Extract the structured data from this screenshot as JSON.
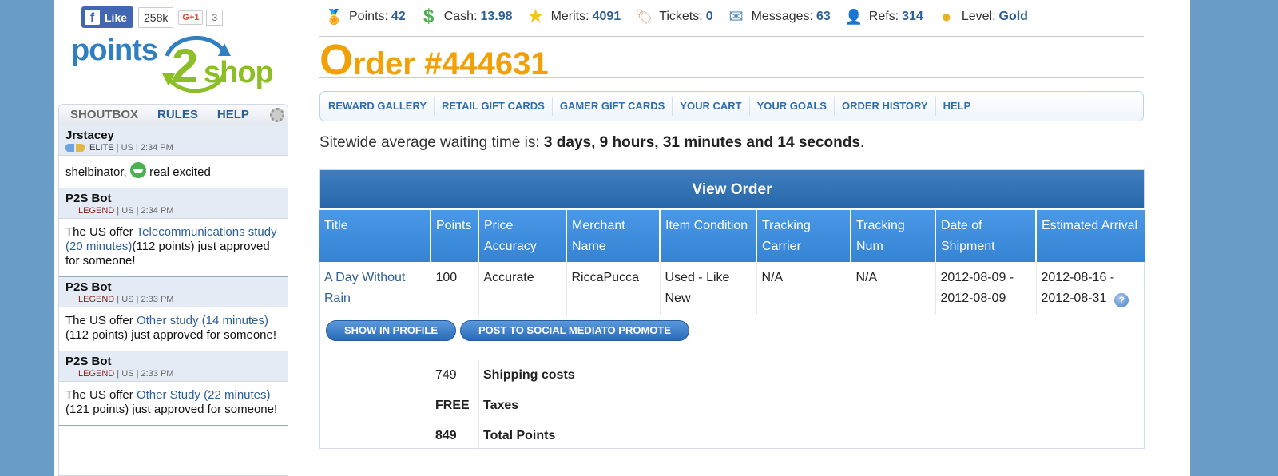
{
  "social": {
    "fb_like": "Like",
    "fb_count": "258k",
    "gplus": "+1",
    "gplus_count": "3"
  },
  "logo": {
    "points": "points",
    "two": "2",
    "shop": "shop"
  },
  "shoutbox": {
    "tabs": [
      "SHOUTBOX",
      "RULES",
      "HELP"
    ],
    "messages": [
      {
        "user": "Jrstacey",
        "rank": "ELITE",
        "region": "US",
        "time": "2:34 PM",
        "pre": "shelbinator,",
        "link": "",
        "post": "real excited"
      },
      {
        "user": "P2S Bot",
        "rank": "LEGEND",
        "region": "US",
        "time": "2:34 PM",
        "pre": "The US offer",
        "link": "Telecommunications study (20 minutes)",
        "post": "(112 points) just approved for someone!"
      },
      {
        "user": "P2S Bot",
        "rank": "LEGEND",
        "region": "US",
        "time": "2:33 PM",
        "pre": "The US offer",
        "link": "Other study (14 minutes)",
        "post": "(112 points) just approved for someone!"
      },
      {
        "user": "P2S Bot",
        "rank": "LEGEND",
        "region": "US",
        "time": "2:33 PM",
        "pre": "The US offer",
        "link": "Other Study (22 minutes)",
        "post": "(121 points) just approved for someone!"
      }
    ]
  },
  "stats": [
    {
      "label": "Points:",
      "value": "42",
      "icon": "points-medal-icon",
      "glyph": "🏅"
    },
    {
      "label": "Cash:",
      "value": "13.98",
      "icon": "dollar-icon",
      "glyph": "$"
    },
    {
      "label": "Merits:",
      "value": "4091",
      "icon": "star-icon",
      "glyph": "★"
    },
    {
      "label": "Tickets:",
      "value": "0",
      "icon": "ticket-icon",
      "glyph": "🏷"
    },
    {
      "label": "Messages:",
      "value": "63",
      "icon": "envelope-icon",
      "glyph": "✉"
    },
    {
      "label": "Refs:",
      "value": "314",
      "icon": "user-icon",
      "glyph": "👤"
    },
    {
      "label": "Level:",
      "value": "Gold",
      "icon": "gold-medal-icon",
      "glyph": "●"
    }
  ],
  "page": {
    "title_first": "O",
    "title_rest": "rder #444631"
  },
  "nav": [
    "REWARD GALLERY",
    "RETAIL GIFT CARDS",
    "GAMER GIFT CARDS",
    "YOUR CART",
    "YOUR GOALS",
    "ORDER HISTORY",
    "HELP"
  ],
  "wait": {
    "prefix": "Sitewide average waiting time is:",
    "value": "3 days, 9 hours, 31 minutes and 14 seconds",
    "suffix": "."
  },
  "order": {
    "heading": "View Order",
    "columns": [
      "Title",
      "Points",
      "Price Accuracy",
      "Merchant Name",
      "Item Condition",
      "Tracking Carrier",
      "Tracking Num",
      "Date of Shipment",
      "Estimated Arrival"
    ],
    "row": [
      "A Day Without Rain",
      "100",
      "Accurate",
      "RiccaPucca",
      "Used - Like New",
      "N/A",
      "N/A",
      "2012-08-09 - 2012-08-09",
      "2012-08-16 - 2012-08-31"
    ],
    "buttons": [
      "SHOW IN PROFILE",
      "POST TO SOCIAL MEDIATO PROMOTE"
    ],
    "totals": [
      {
        "value": "749",
        "label": "Shipping costs"
      },
      {
        "value": "FREE",
        "label": "Taxes"
      },
      {
        "value": "849",
        "label": "Total Points"
      }
    ]
  },
  "colors": {
    "accent": "#f2a007",
    "link": "#2d5f96",
    "header_blue": "#3584d4",
    "background": "#6a9cc8"
  }
}
